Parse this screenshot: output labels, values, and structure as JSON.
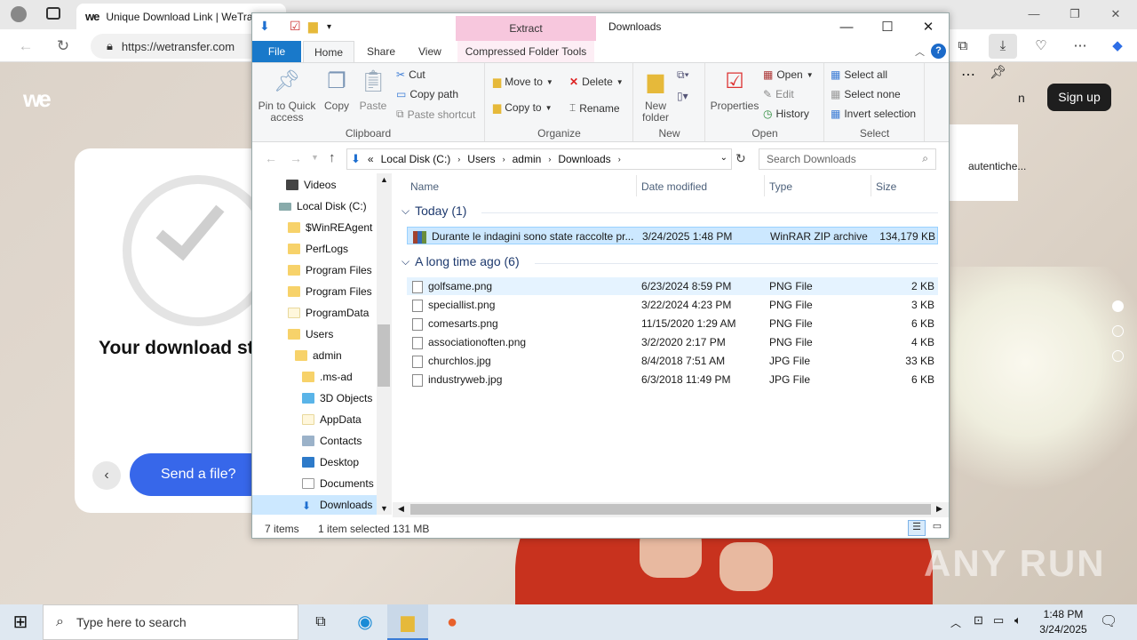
{
  "browser": {
    "tab_title": "Unique Download Link | WeTransfer",
    "url": "https://wetransfer.com",
    "right_panel_text": "autentiche...",
    "signup_label": "Sign up",
    "partial_text": "n"
  },
  "page": {
    "logo": "we",
    "card_title": "Your download started",
    "send_label": "Send a file?"
  },
  "watermark": "ANY RUN",
  "explorer": {
    "contextual_tab": "Extract",
    "title": "Downloads",
    "tabs": {
      "file": "File",
      "home": "Home",
      "share": "Share",
      "view": "View",
      "compressed": "Compressed Folder Tools"
    },
    "ribbon": {
      "clipboard": {
        "label": "Clipboard",
        "pin": "Pin to Quick access",
        "copy": "Copy",
        "paste": "Paste",
        "cut": "Cut",
        "copy_path": "Copy path",
        "paste_shortcut": "Paste shortcut"
      },
      "organize": {
        "label": "Organize",
        "move_to": "Move to",
        "copy_to": "Copy to",
        "delete": "Delete",
        "rename": "Rename"
      },
      "new": {
        "label": "New",
        "new_folder": "New folder"
      },
      "open": {
        "label": "Open",
        "properties": "Properties",
        "open": "Open",
        "edit": "Edit",
        "history": "History"
      },
      "select": {
        "label": "Select",
        "select_all": "Select all",
        "select_none": "Select none",
        "invert": "Invert selection"
      }
    },
    "breadcrumb": [
      "«",
      "Local Disk (C:)",
      "Users",
      "admin",
      "Downloads"
    ],
    "search_placeholder": "Search Downloads",
    "tree": [
      {
        "label": "Videos",
        "icon": "video-folder"
      },
      {
        "label": "Local Disk (C:)",
        "icon": "drive"
      },
      {
        "label": "$WinREAgent",
        "icon": "folder"
      },
      {
        "label": "PerfLogs",
        "icon": "folder"
      },
      {
        "label": "Program Files",
        "icon": "folder"
      },
      {
        "label": "Program Files",
        "icon": "folder"
      },
      {
        "label": "ProgramData",
        "icon": "folder"
      },
      {
        "label": "Users",
        "icon": "folder"
      },
      {
        "label": "admin",
        "icon": "folder"
      },
      {
        "label": ".ms-ad",
        "icon": "folder"
      },
      {
        "label": "3D Objects",
        "icon": "3d"
      },
      {
        "label": "AppData",
        "icon": "folder"
      },
      {
        "label": "Contacts",
        "icon": "contacts"
      },
      {
        "label": "Desktop",
        "icon": "desktop"
      },
      {
        "label": "Documents",
        "icon": "documents"
      },
      {
        "label": "Downloads",
        "icon": "downloads"
      }
    ],
    "columns": {
      "name": "Name",
      "date": "Date modified",
      "type": "Type",
      "size": "Size"
    },
    "groups": [
      {
        "label": "Today (1)",
        "files": [
          {
            "name": "Durante le indagini sono state raccolte pr...",
            "date": "3/24/2025 1:48 PM",
            "type": "WinRAR ZIP archive",
            "size": "134,179 KB"
          }
        ]
      },
      {
        "label": "A long time ago (6)",
        "files": [
          {
            "name": "golfsame.png",
            "date": "6/23/2024 8:59 PM",
            "type": "PNG File",
            "size": "2 KB"
          },
          {
            "name": "speciallist.png",
            "date": "3/22/2024 4:23 PM",
            "type": "PNG File",
            "size": "3 KB"
          },
          {
            "name": "comesarts.png",
            "date": "11/15/2020 1:29 AM",
            "type": "PNG File",
            "size": "6 KB"
          },
          {
            "name": "associationoften.png",
            "date": "3/2/2020 2:17 PM",
            "type": "PNG File",
            "size": "4 KB"
          },
          {
            "name": "churchlos.jpg",
            "date": "8/4/2018 7:51 AM",
            "type": "JPG File",
            "size": "33 KB"
          },
          {
            "name": "industryweb.jpg",
            "date": "6/3/2018 11:49 PM",
            "type": "JPG File",
            "size": "6 KB"
          }
        ]
      }
    ],
    "status": {
      "items": "7 items",
      "selected": "1 item selected",
      "size": "131 MB"
    }
  },
  "taskbar": {
    "search_placeholder": "Type here to search",
    "time": "1:48 PM",
    "date": "3/24/2025"
  }
}
